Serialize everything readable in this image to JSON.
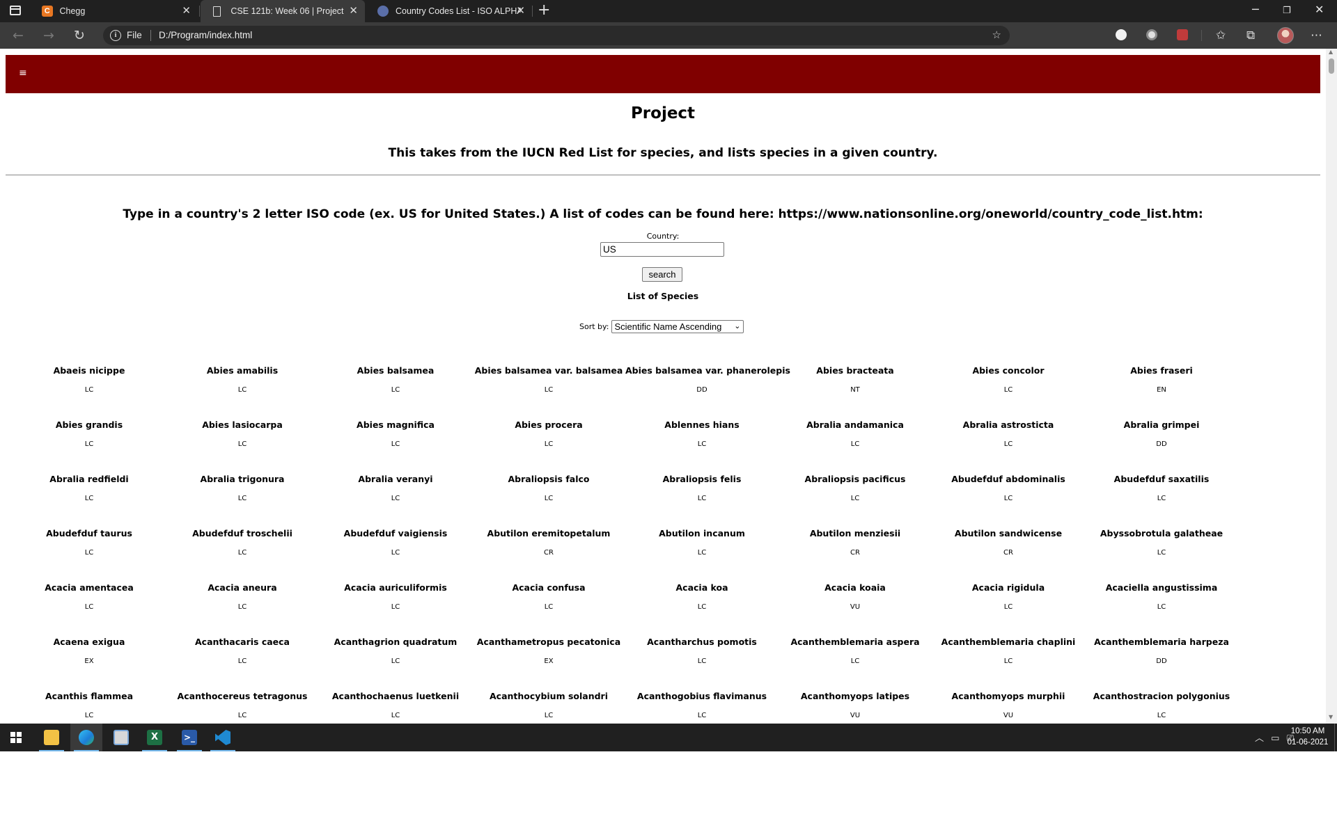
{
  "browser": {
    "tabs": [
      {
        "title": "Chegg",
        "favicon": "chegg-icon",
        "active": false
      },
      {
        "title": "CSE 121b: Week 06 | Project",
        "favicon": "page-icon",
        "active": true
      },
      {
        "title": "Country Codes List - ISO ALPHA",
        "favicon": "globe-icon",
        "active": false
      }
    ],
    "address": {
      "scheme_label": "File",
      "url": "D:/Program/index.html"
    },
    "colors": {
      "tabbar": "#202020",
      "toolbar": "#3b3b3b"
    }
  },
  "page": {
    "nav_menu_glyph": "≡",
    "nav_color": "#800000",
    "title": "Project",
    "subtitle": "This takes from the IUCN Red List for species, and lists species in a given country.",
    "instructions": "Type in a country's 2 letter ISO code (ex. US for United States.) A list of codes can be found here: https://www.nationsonline.org/oneworld/country_code_list.htm:",
    "country_label": "Country:",
    "country_value": "US",
    "search_label": "search",
    "list_heading": "List of Species",
    "sort_label": "Sort by:",
    "sort_selected": "Scientific Name Ascending"
  },
  "species": [
    {
      "name": "Abaeis nicippe",
      "status": "LC"
    },
    {
      "name": "Abies amabilis",
      "status": "LC"
    },
    {
      "name": "Abies balsamea",
      "status": "LC"
    },
    {
      "name": "Abies balsamea var. balsamea",
      "status": "LC"
    },
    {
      "name": "Abies balsamea var. phanerolepis",
      "status": "DD"
    },
    {
      "name": "Abies bracteata",
      "status": "NT"
    },
    {
      "name": "Abies concolor",
      "status": "LC"
    },
    {
      "name": "Abies fraseri",
      "status": "EN"
    },
    {
      "name": "Abies grandis",
      "status": "LC"
    },
    {
      "name": "Abies lasiocarpa",
      "status": "LC"
    },
    {
      "name": "Abies magnifica",
      "status": "LC"
    },
    {
      "name": "Abies procera",
      "status": "LC"
    },
    {
      "name": "Ablennes hians",
      "status": "LC"
    },
    {
      "name": "Abralia andamanica",
      "status": "LC"
    },
    {
      "name": "Abralia astrosticta",
      "status": "LC"
    },
    {
      "name": "Abralia grimpei",
      "status": "DD"
    },
    {
      "name": "Abralia redfieldi",
      "status": "LC"
    },
    {
      "name": "Abralia trigonura",
      "status": "LC"
    },
    {
      "name": "Abralia veranyi",
      "status": "LC"
    },
    {
      "name": "Abraliopsis falco",
      "status": "LC"
    },
    {
      "name": "Abraliopsis felis",
      "status": "LC"
    },
    {
      "name": "Abraliopsis pacificus",
      "status": "LC"
    },
    {
      "name": "Abudefduf abdominalis",
      "status": "LC"
    },
    {
      "name": "Abudefduf saxatilis",
      "status": "LC"
    },
    {
      "name": "Abudefduf taurus",
      "status": "LC"
    },
    {
      "name": "Abudefduf troschelii",
      "status": "LC"
    },
    {
      "name": "Abudefduf vaigiensis",
      "status": "LC"
    },
    {
      "name": "Abutilon eremitopetalum",
      "status": "CR"
    },
    {
      "name": "Abutilon incanum",
      "status": "LC"
    },
    {
      "name": "Abutilon menziesii",
      "status": "CR"
    },
    {
      "name": "Abutilon sandwicense",
      "status": "CR"
    },
    {
      "name": "Abyssobrotula galatheae",
      "status": "LC"
    },
    {
      "name": "Acacia amentacea",
      "status": "LC"
    },
    {
      "name": "Acacia aneura",
      "status": "LC"
    },
    {
      "name": "Acacia auriculiformis",
      "status": "LC"
    },
    {
      "name": "Acacia confusa",
      "status": "LC"
    },
    {
      "name": "Acacia koa",
      "status": "LC"
    },
    {
      "name": "Acacia koaia",
      "status": "VU"
    },
    {
      "name": "Acacia rigidula",
      "status": "LC"
    },
    {
      "name": "Acaciella angustissima",
      "status": "LC"
    },
    {
      "name": "Acaena exigua",
      "status": "EX"
    },
    {
      "name": "Acanthacaris caeca",
      "status": "LC"
    },
    {
      "name": "Acanthagrion quadratum",
      "status": "LC"
    },
    {
      "name": "Acanthametropus pecatonica",
      "status": "EX"
    },
    {
      "name": "Acantharchus pomotis",
      "status": "LC"
    },
    {
      "name": "Acanthemblemaria aspera",
      "status": "LC"
    },
    {
      "name": "Acanthemblemaria chaplini",
      "status": "LC"
    },
    {
      "name": "Acanthemblemaria harpeza",
      "status": "DD"
    },
    {
      "name": "Acanthis flammea",
      "status": "LC"
    },
    {
      "name": "Acanthocereus tetragonus",
      "status": "LC"
    },
    {
      "name": "Acanthochaenus luetkenii",
      "status": "LC"
    },
    {
      "name": "Acanthocybium solandri",
      "status": "LC"
    },
    {
      "name": "Acanthogobius flavimanus",
      "status": "LC"
    },
    {
      "name": "Acanthomyops latipes",
      "status": "VU"
    },
    {
      "name": "Acanthomyops murphii",
      "status": "VU"
    },
    {
      "name": "Acanthostracion polygonius",
      "status": "LC"
    }
  ],
  "taskbar": {
    "apps": [
      "file-explorer-icon",
      "edge-icon",
      "snipping-tool-icon",
      "excel-icon",
      "powershell-icon",
      "vscode-icon"
    ],
    "time": "10:50 AM",
    "date": "01-06-2021"
  }
}
